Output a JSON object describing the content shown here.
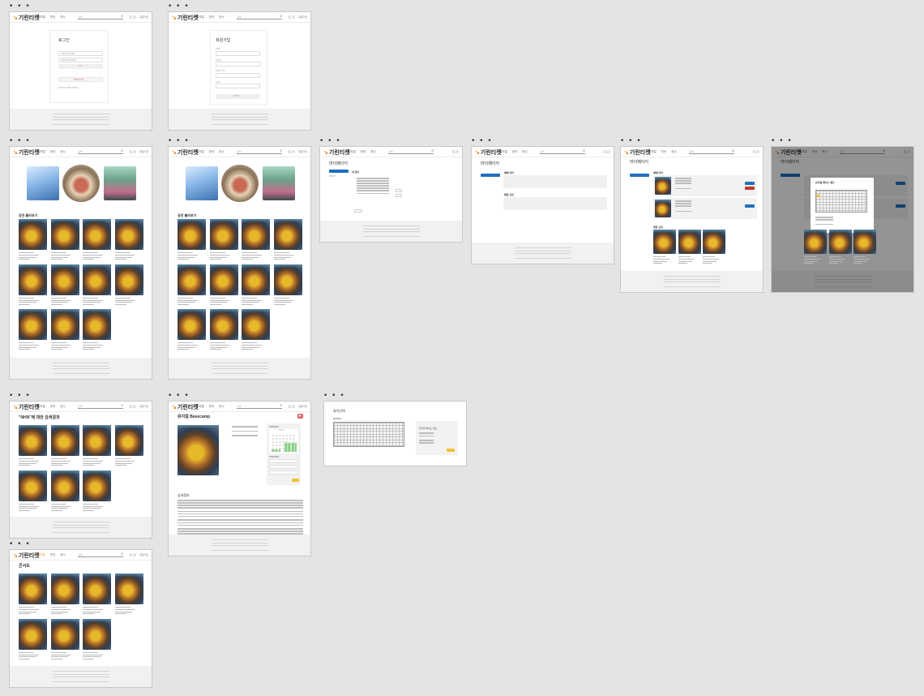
{
  "app": {
    "logo_text": "기린티켓",
    "nav": [
      "뮤지컬",
      "연극",
      "전시"
    ],
    "search_placeholder": "검색",
    "utility": [
      "로그인",
      "회원가입"
    ],
    "window_dots": "• • •"
  },
  "login": {
    "title": "로그인",
    "email_placeholder": "이메일을 입력하세요",
    "password_placeholder": "비밀번호를 입력하세요",
    "login_button": "로그인",
    "kakao_button": "카카오 로그인",
    "signup_prompt": "회원이 아니신가요? 회원가입"
  },
  "signup": {
    "title": "회원가입",
    "fields": [
      "이메일",
      "비밀번호",
      "비밀번호 확인",
      "닉네임"
    ],
    "submit_button": "회원가입"
  },
  "home": {
    "section_title": "공연 둘러보기"
  },
  "mypage": {
    "title": "마이페이지",
    "side_menu": [
      "내 정보",
      "예매 내역",
      "찜한 공연"
    ],
    "info_title": "내 정보",
    "reservation_title": "예매 내역",
    "liked_title": "찜한 공연"
  },
  "search": {
    "result_title": "\"NHN\"에 대한 검색결과"
  },
  "category": {
    "title": "콘서트"
  },
  "detail": {
    "title": "뮤지컬 Basecamp",
    "description_title": "상세정보",
    "calendar_month": "2023.11"
  },
  "seat": {
    "title": "좌석선택",
    "summary_title": "뮤지컬 베이스 캠프",
    "select_button": "선택"
  }
}
